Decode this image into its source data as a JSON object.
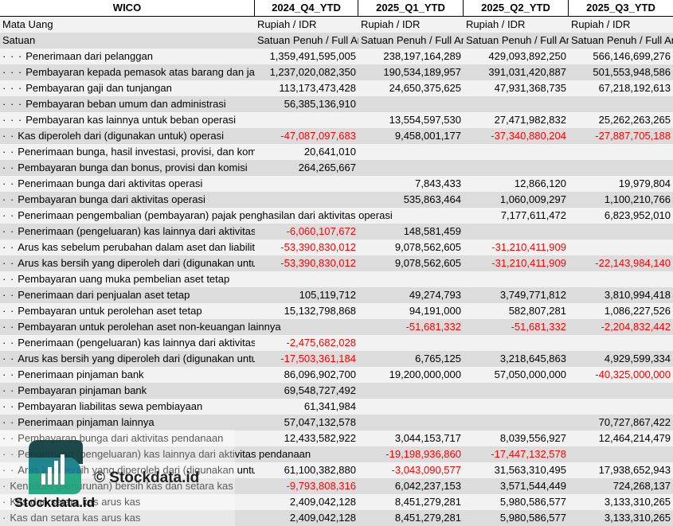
{
  "header": {
    "title": "WICO",
    "columns": [
      "2024_Q4_YTD",
      "2025_Q1_YTD",
      "2025_Q2_YTD",
      "2025_Q3_YTD"
    ]
  },
  "meta_rows": [
    {
      "label": "Mata Uang",
      "values": [
        "Rupiah / IDR",
        "Rupiah / IDR",
        "Rupiah / IDR",
        "Rupiah / IDR"
      ]
    },
    {
      "label": "Satuan",
      "values": [
        "Satuan Penuh / Full Amount",
        "Satuan Penuh / Full Amount",
        "Satuan Penuh / Full Amount",
        "Satuan Penuh / Full Amount"
      ]
    }
  ],
  "rows": [
    {
      "dots": "· · ·",
      "label": "Penerimaan dari pelanggan",
      "values": [
        "1,359,491,595,005",
        "238,197,164,289",
        "429,093,892,250",
        "566,146,699,276"
      ]
    },
    {
      "dots": "· · ·",
      "label": "Pembayaran kepada pemasok atas barang dan jasa",
      "values": [
        "1,237,020,082,350",
        "190,534,189,957",
        "391,031,420,887",
        "501,553,948,586"
      ]
    },
    {
      "dots": "· · ·",
      "label": "Pembayaran gaji dan tunjangan",
      "values": [
        "113,173,473,428",
        "24,650,375,625",
        "47,931,368,735",
        "67,218,192,613"
      ]
    },
    {
      "dots": "· · ·",
      "label": "Pembayaran beban umum dan administrasi",
      "values": [
        "56,385,136,910",
        "",
        "",
        ""
      ]
    },
    {
      "dots": "· · ·",
      "label": "Pembayaran kas lainnya untuk beban operasi",
      "values": [
        "",
        "13,554,597,530",
        "27,471,982,832",
        "25,262,263,265"
      ]
    },
    {
      "dots": "· ·",
      "label": "Kas diperoleh dari (digunakan untuk) operasi",
      "values": [
        "-47,087,097,683",
        "9,458,001,177",
        "-37,340,880,204",
        "-27,887,705,188"
      ]
    },
    {
      "dots": "· ·",
      "label": "Penerimaan bunga, hasil investasi, provisi, dan komisi",
      "values": [
        "20,641,010",
        "",
        "",
        ""
      ]
    },
    {
      "dots": "· ·",
      "label": "Pembayaran bunga dan bonus, provisi dan komisi",
      "values": [
        "264,265,667",
        "",
        "",
        ""
      ]
    },
    {
      "dots": "· ·",
      "label": "Penerimaan bunga dari aktivitas operasi",
      "values": [
        "",
        "7,843,433",
        "12,866,120",
        "19,979,804"
      ]
    },
    {
      "dots": "· ·",
      "label": "Pembayaran bunga dari aktivitas operasi",
      "values": [
        "",
        "535,863,464",
        "1,060,009,297",
        "1,100,210,766"
      ]
    },
    {
      "dots": "· ·",
      "label": "Penerimaan pengembalian (pembayaran) pajak penghasilan dari aktivitas operasi",
      "values": [
        "",
        "",
        "7,177,611,472",
        "6,823,952,010"
      ]
    },
    {
      "dots": "· ·",
      "label": "Penerimaan (pengeluaran) kas lainnya dari aktivitas operasi",
      "values": [
        "-6,060,107,672",
        "148,581,459",
        "",
        ""
      ]
    },
    {
      "dots": "· ·",
      "label": "Arus kas sebelum perubahan dalam aset dan liabilitas",
      "values": [
        "-53,390,830,012",
        "9,078,562,605",
        "-31,210,411,909",
        ""
      ]
    },
    {
      "dots": "· ·",
      "label": "Arus kas bersih yang diperoleh dari (digunakan untuk) aktivitas operasi",
      "values": [
        "-53,390,830,012",
        "9,078,562,605",
        "-31,210,411,909",
        "-22,143,984,140"
      ]
    },
    {
      "dots": "· ·",
      "label": "Pembayaran uang muka pembelian aset tetap",
      "values": [
        "",
        "",
        "",
        ""
      ]
    },
    {
      "dots": "· ·",
      "label": "Penerimaan dari penjualan aset tetap",
      "values": [
        "105,119,712",
        "49,274,793",
        "3,749,771,812",
        "3,810,994,418"
      ]
    },
    {
      "dots": "· ·",
      "label": "Pembayaran untuk perolehan aset tetap",
      "values": [
        "15,132,798,868",
        "94,191,000",
        "582,807,281",
        "1,086,227,526"
      ]
    },
    {
      "dots": "· ·",
      "label": "Pembayaran untuk perolehan aset non-keuangan lainnya",
      "values": [
        "",
        "-51,681,332",
        "-51,681,332",
        "-2,204,832,442"
      ]
    },
    {
      "dots": "· ·",
      "label": "Penerimaan (pengeluaran) kas lainnya dari aktivitas investasi",
      "values": [
        "-2,475,682,028",
        "",
        "",
        ""
      ]
    },
    {
      "dots": "· ·",
      "label": "Arus kas bersih yang diperoleh dari (digunakan untuk) aktivitas investasi",
      "values": [
        "-17,503,361,184",
        "6,765,125",
        "3,218,645,863",
        "4,929,599,334"
      ]
    },
    {
      "dots": "· ·",
      "label": "Penerimaan pinjaman bank",
      "values": [
        "86,096,902,700",
        "19,200,000,000",
        "57,050,000,000",
        "-40,325,000,000"
      ]
    },
    {
      "dots": "· ·",
      "label": "Pembayaran pinjaman bank",
      "values": [
        "69,548,727,492",
        "",
        "",
        ""
      ]
    },
    {
      "dots": "· ·",
      "label": "Pembayaran liabilitas sewa pembiayaan",
      "values": [
        "61,341,984",
        "",
        "",
        ""
      ]
    },
    {
      "dots": "· ·",
      "label": "Penerimaan pinjaman lainnya",
      "values": [
        "57,047,132,578",
        "",
        "",
        "70,727,867,422"
      ]
    },
    {
      "dots": "· ·",
      "label": "Pembayaran bunga dari aktivitas pendanaan",
      "values": [
        "12,433,582,922",
        "3,044,153,717",
        "8,039,556,927",
        "12,464,214,479"
      ]
    },
    {
      "dots": "· ·",
      "label": "Penerimaan (pengeluaran) kas lainnya dari aktivitas pendanaan",
      "values": [
        "",
        "-19,198,936,860",
        "-17,447,132,578",
        ""
      ]
    },
    {
      "dots": "· ·",
      "label": "Arus kas bersih yang diperoleh dari (digunakan untuk) aktivitas pendanaan",
      "values": [
        "61,100,382,880",
        "-3,043,090,577",
        "31,563,310,495",
        "17,938,652,943"
      ]
    },
    {
      "dots": "·",
      "label": "Kenaikan (penurunan) bersih kas dan setara kas",
      "values": [
        "-9,793,808,316",
        "6,042,237,153",
        "3,571,544,449",
        "724,268,137"
      ]
    },
    {
      "dots": "·",
      "label": "Kas dan setara kas arus kas",
      "values": [
        "2,409,042,128",
        "8,451,279,281",
        "5,980,586,577",
        "3,133,310,265"
      ]
    },
    {
      "dots": "·",
      "label": "Kas dan setara kas arus kas",
      "values": [
        "2,409,042,128",
        "8,451,279,281",
        "5,980,586,577",
        "3,133,310,265"
      ]
    }
  ],
  "watermark": {
    "text": "© Stockdata.id",
    "logo_text": "Stockdata.id"
  },
  "colors": {
    "negative": "#ff0000",
    "row_light": "#f2f2f2",
    "row_grey": "#dcdcdc",
    "logo_dark": "#0b3b3c",
    "logo_teal": "#0e7c86",
    "logo_green": "#1aa37a"
  }
}
